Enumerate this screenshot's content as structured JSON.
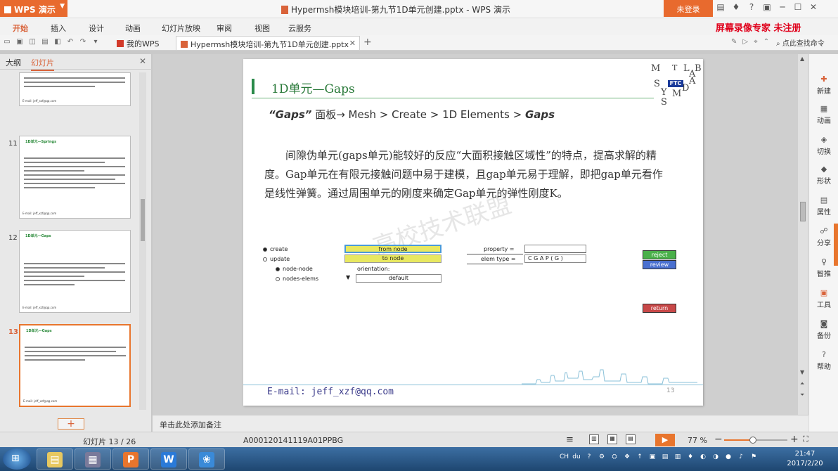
{
  "titlebar": {
    "app_name": "WPS 演示",
    "doc_title": "Hypermsh模块培训-第九节1D单元创建.pptx - WPS 演示",
    "login": "未登录"
  },
  "ribbon": {
    "tabs": [
      "开始",
      "插入",
      "设计",
      "动画",
      "幻灯片放映",
      "审阅",
      "视图",
      "云服务"
    ],
    "active_tab": "开始",
    "recorder_label": "屏幕录像专家  未注册"
  },
  "doctabs": {
    "mywps": "我的WPS",
    "file": "Hypermsh模块培训-第九节1D单元创建.pptx",
    "search_cmd": "点此查找命令"
  },
  "leftpanel": {
    "tab_outline": "大纲",
    "tab_slides": "幻灯片",
    "slides": [
      {
        "num": "",
        "title": ""
      },
      {
        "num": "11",
        "title": "1D单元—Springs"
      },
      {
        "num": "12",
        "title": "1D单元—Gaps"
      },
      {
        "num": "13",
        "title": "1D单元—Gaps"
      }
    ],
    "active_num": "13"
  },
  "slide": {
    "title": "1D单元—Gaps",
    "logo_letters": [
      "M",
      "T",
      "L",
      "A",
      "B",
      "S",
      "Y",
      "M",
      "S",
      "D",
      "A"
    ],
    "logo_ftc": "FTC",
    "path_quoted": "“Gaps”",
    "path_rest": " 面板→ Mesh > Create > 1D Elements > ",
    "path_end": "Gaps",
    "paragraph": "间隙伪单元(gaps单元)能较好的反应“大面积接触区域性”的特点，提高求解的精度。Gap单元在有限元接触问题中易于建模，且gap单元易于理解，即把gap单元看作是线性弹簧。通过周围单元的刚度来确定Gap单元的弹性刚度K。",
    "watermark": "高校技术联盟",
    "email": "E-mail: jeff_xzf@qq.com",
    "page_num": "13",
    "panel": {
      "create": "create",
      "update": "update",
      "node_node": "node-node",
      "nodes_elems": "nodes-elems",
      "from_node": "from node",
      "to_node": "to node",
      "orientation": "orientation:",
      "default": "default",
      "property": "property =",
      "elem_type": "elem type =",
      "elem_type_value": "C G A P ( G )",
      "reject": "reject",
      "review": "review",
      "return": "return"
    }
  },
  "rightbar": {
    "items": [
      "新建",
      "动画",
      "切换",
      "形状",
      "属性",
      "分享",
      "智推",
      "工具",
      "备份",
      "帮助"
    ]
  },
  "notes": {
    "placeholder": "单击此处添加备注"
  },
  "status": {
    "slide_count": "幻灯片 13 / 26",
    "template": "A000120141119A01PPBG",
    "zoom": "77 %",
    "zoom_fraction": 0.45
  },
  "taskbar": {
    "tray": [
      "CH",
      "du",
      "?",
      "⚙",
      "⛭",
      "❖",
      "↑",
      "▣",
      "▤",
      "▥",
      "♦",
      "◐",
      "◑",
      "●",
      "♪",
      "⚑"
    ],
    "time": "21:47",
    "date": "2017/2/20"
  },
  "colors": {
    "brand": "#e8752d",
    "title_green": "#2a7a3a",
    "recorder_red": "#e0001b"
  }
}
